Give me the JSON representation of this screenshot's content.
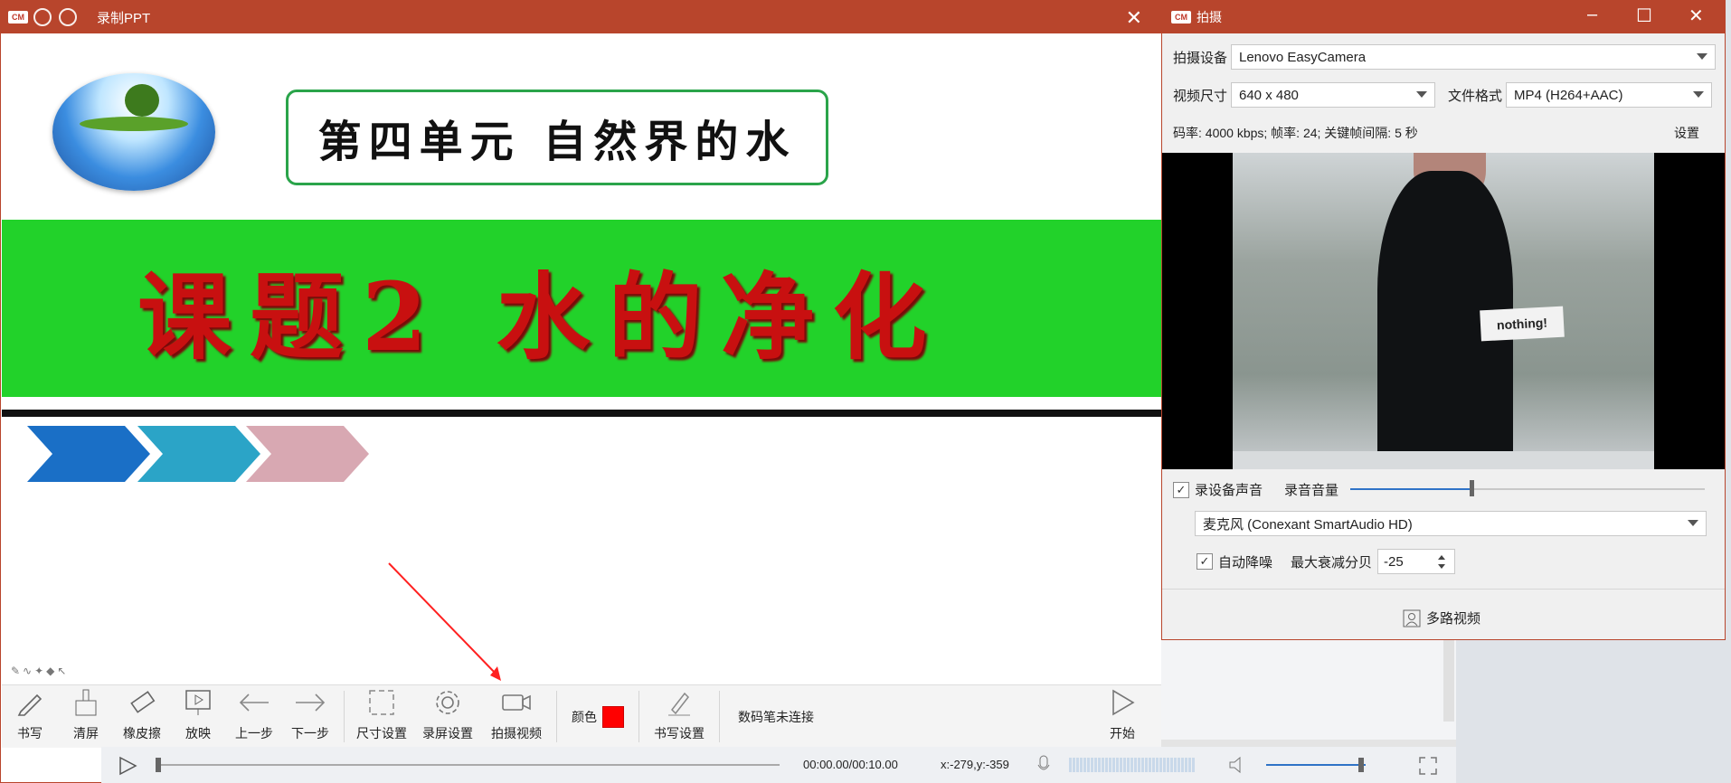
{
  "main_window": {
    "title": "录制PPT"
  },
  "slide": {
    "unit_title": "第四单元  自然界的水",
    "lesson_title": "课题2 水的净化",
    "chevron_colors": [
      "#1a6fc6",
      "#2ba4c7",
      "#d8a8b2"
    ]
  },
  "toolbar": {
    "write": "书写",
    "clear": "清屏",
    "eraser": "橡皮擦",
    "play": "放映",
    "prev": "上一步",
    "next": "下一步",
    "size_settings": "尺寸设置",
    "record_settings": "录屏设置",
    "camera_video": "拍摄视频",
    "color_label": "颜色",
    "color_value": "#ff0000",
    "pen_settings": "书写设置",
    "pen_status": "数码笔未连接",
    "start": "开始"
  },
  "playback": {
    "time": "00:00.00/00:10.00",
    "coords": "x:-279,y:-359"
  },
  "camera_window": {
    "title": "拍摄",
    "device_label": "拍摄设备",
    "device_value": "Lenovo EasyCamera",
    "size_label": "视频尺寸",
    "size_value": "640 x 480",
    "format_label": "文件格式",
    "format_value": "MP4 (H264+AAC)",
    "info": "码率: 4000 kbps; 帧率: 24; 关键帧间隔: 5 秒",
    "settings_link": "设置",
    "preview_shirt_text": "nothing!",
    "record_audio_label": "录设备声音",
    "record_audio_checked": true,
    "volume_label": "录音音量",
    "volume_level": 0.33,
    "mic_value": "麦克风 (Conexant SmartAudio HD)",
    "denoise_label": "自动降噪",
    "denoise_checked": true,
    "max_atten_label": "最大衰减分贝",
    "max_atten_value": "-25",
    "multi_video": "多路视频"
  }
}
